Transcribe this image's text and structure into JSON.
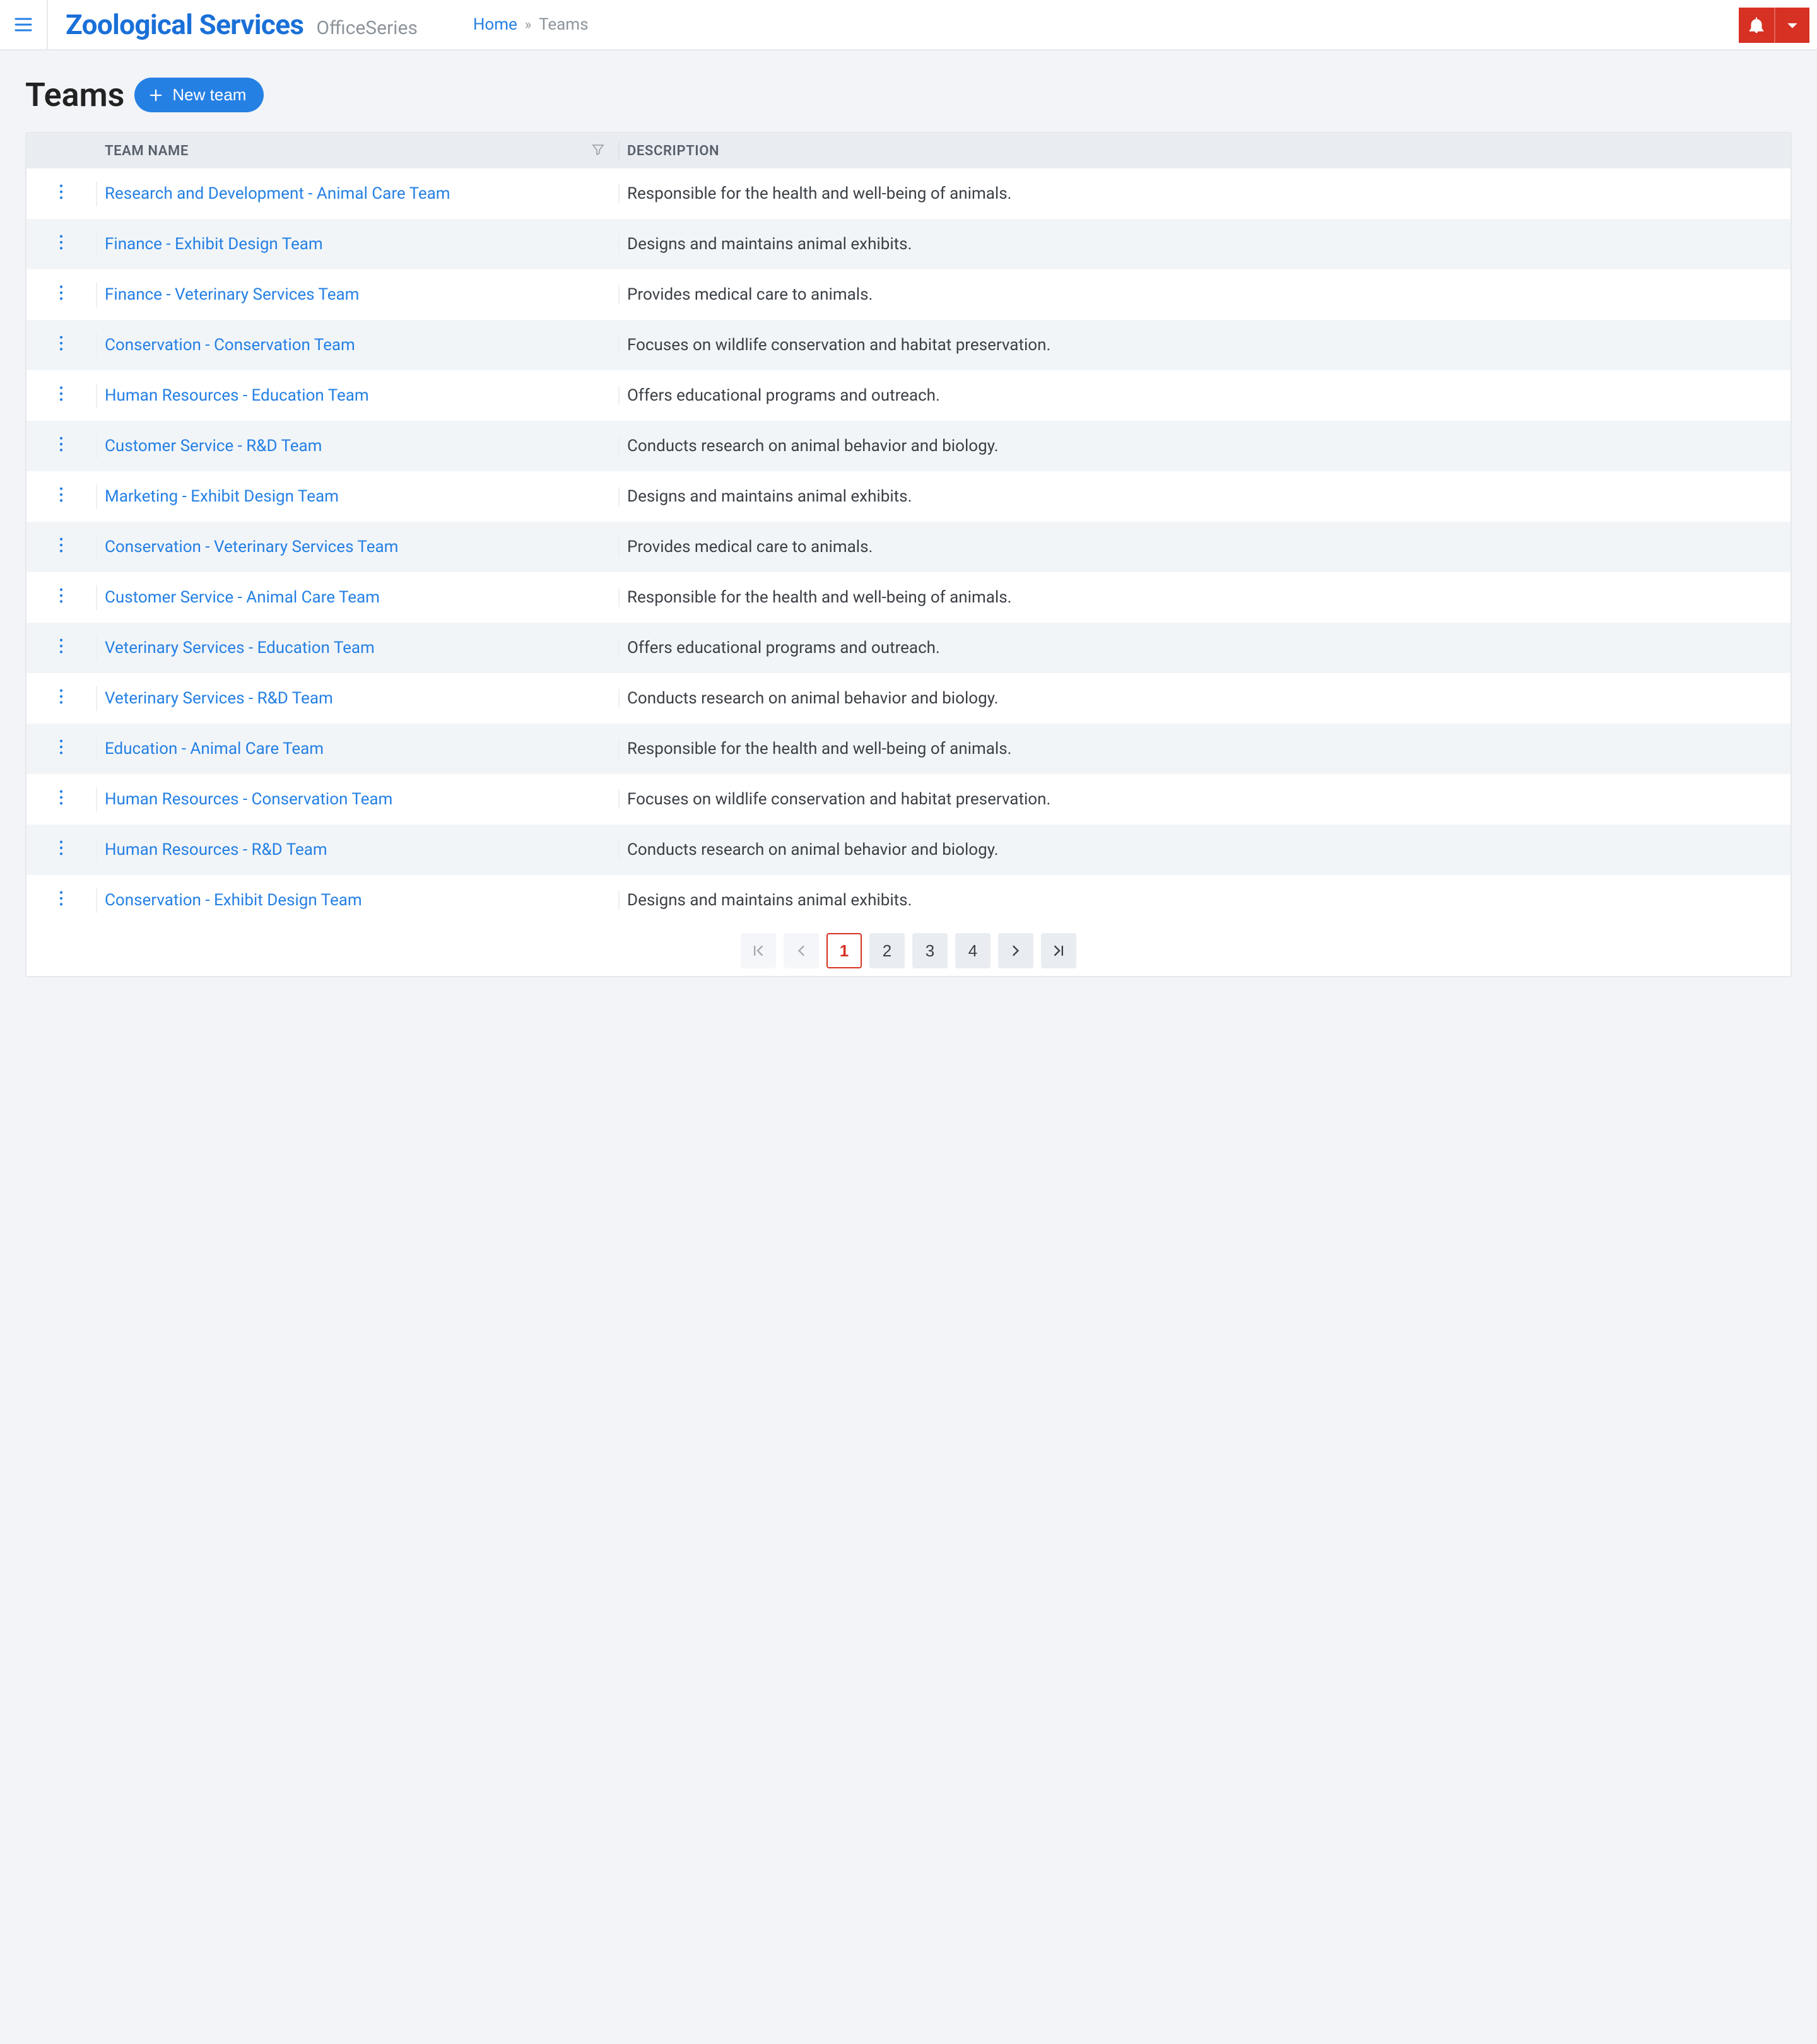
{
  "header": {
    "brand": "Zoological Services",
    "subtitle": "OfficeSeries",
    "crumbs": {
      "home": "Home",
      "current": "Teams"
    }
  },
  "page": {
    "title": "Teams",
    "new_button": "New team"
  },
  "table": {
    "columns": {
      "name": "TEAM NAME",
      "description": "DESCRIPTION"
    },
    "rows": [
      {
        "name": "Research and Development - Animal Care Team",
        "description": "Responsible for the health and well-being of animals."
      },
      {
        "name": "Finance - Exhibit Design Team",
        "description": "Designs and maintains animal exhibits."
      },
      {
        "name": "Finance - Veterinary Services Team",
        "description": "Provides medical care to animals."
      },
      {
        "name": "Conservation - Conservation Team",
        "description": "Focuses on wildlife conservation and habitat preservation."
      },
      {
        "name": "Human Resources - Education Team",
        "description": "Offers educational programs and outreach."
      },
      {
        "name": "Customer Service - R&D Team",
        "description": "Conducts research on animal behavior and biology."
      },
      {
        "name": "Marketing - Exhibit Design Team",
        "description": "Designs and maintains animal exhibits."
      },
      {
        "name": "Conservation - Veterinary Services Team",
        "description": "Provides medical care to animals."
      },
      {
        "name": "Customer Service - Animal Care Team",
        "description": "Responsible for the health and well-being of animals."
      },
      {
        "name": "Veterinary Services - Education Team",
        "description": "Offers educational programs and outreach."
      },
      {
        "name": "Veterinary Services - R&D Team",
        "description": "Conducts research on animal behavior and biology."
      },
      {
        "name": "Education - Animal Care Team",
        "description": "Responsible for the health and well-being of animals."
      },
      {
        "name": "Human Resources - Conservation Team",
        "description": "Focuses on wildlife conservation and habitat preservation."
      },
      {
        "name": "Human Resources - R&D Team",
        "description": "Conducts research on animal behavior and biology."
      },
      {
        "name": "Conservation - Exhibit Design Team",
        "description": "Designs and maintains animal exhibits."
      }
    ]
  },
  "pagination": {
    "pages": [
      "1",
      "2",
      "3",
      "4"
    ],
    "current": "1"
  }
}
